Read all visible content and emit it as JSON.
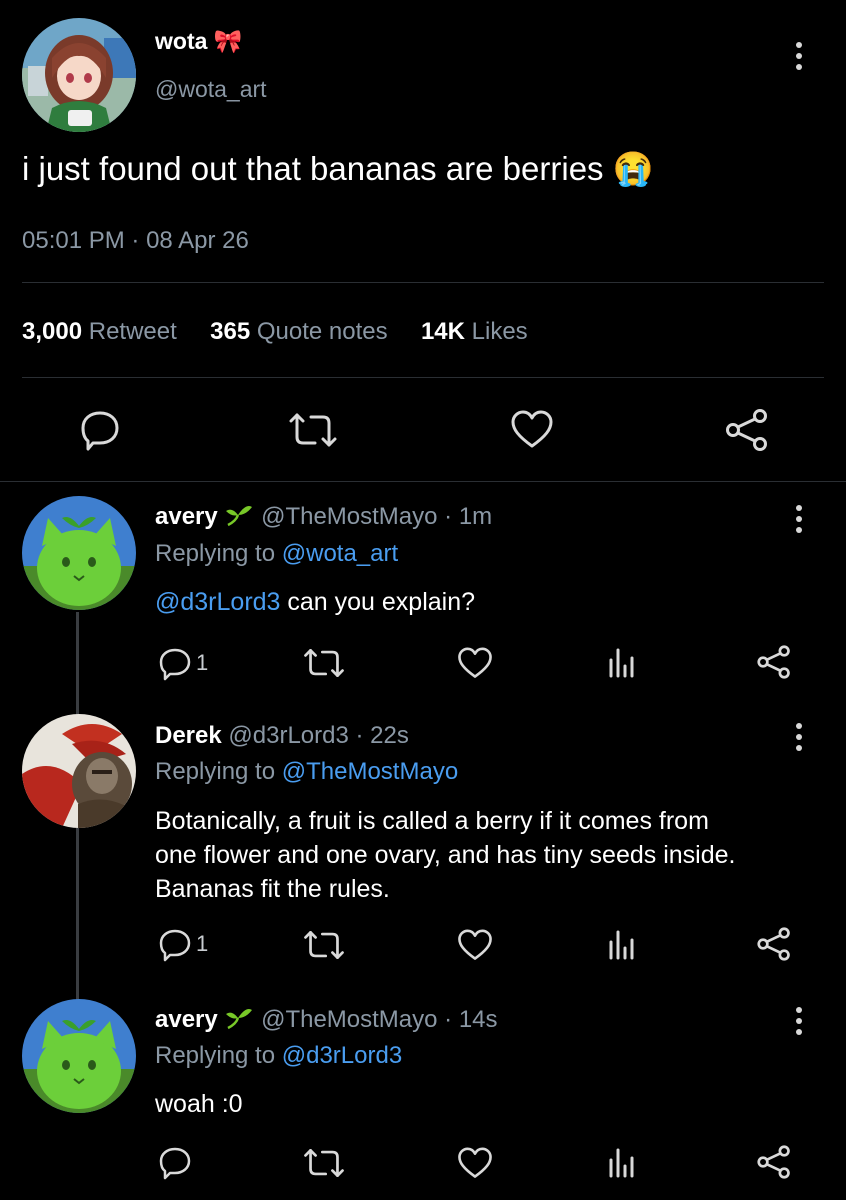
{
  "main_tweet": {
    "display_name": "wota",
    "name_emoji": "🎀",
    "handle": "@wota_art",
    "text": "i just found out that bananas are berries",
    "text_emoji": "😭",
    "time": "05:01 PM",
    "sep": "·",
    "date": "08 Apr 26",
    "stats": {
      "retweets_count": "3,000",
      "retweets_label": "Retweet",
      "quotes_count": "365",
      "quotes_label": "Quote notes",
      "likes_count": "14K",
      "likes_label": "Likes"
    }
  },
  "replies": [
    {
      "display_name": "avery",
      "handle": "@TheMostMayo",
      "time": "· 1m",
      "replying_prefix": "Replying to",
      "replying_to": "@wota_art",
      "mention": "@d3rLord3",
      "text": " can you explain?",
      "reply_count": "1"
    },
    {
      "display_name": "Derek",
      "handle": "@d3rLord3",
      "time": "· 22s",
      "replying_prefix": "Replying to",
      "replying_to": "@TheMostMayo",
      "text_line1": "Botanically, a fruit is called a berry if it comes from",
      "text_line2": "one flower and one ovary, and has tiny seeds inside.",
      "text_line3": "Bananas fit the rules.",
      "reply_count": "1"
    },
    {
      "display_name": "avery",
      "handle": "@TheMostMayo",
      "time": "· 14s",
      "replying_prefix": "Replying to",
      "replying_to": "@d3rLord3",
      "text": "woah :0"
    }
  ],
  "colors": {
    "background": "#000000",
    "link": "#4a9df0",
    "muted": "#8b98a5"
  }
}
